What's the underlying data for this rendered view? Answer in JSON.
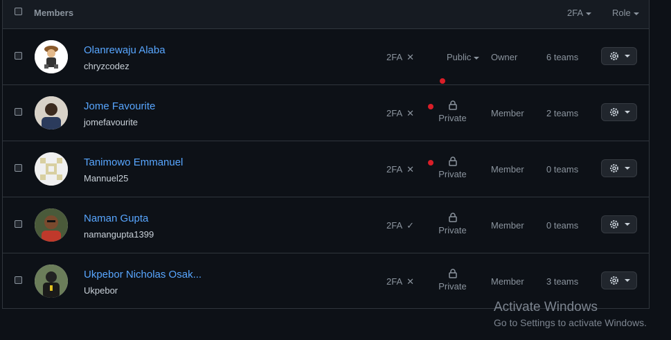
{
  "header": {
    "title": "Members",
    "filters": [
      {
        "label": "2FA"
      },
      {
        "label": "Role"
      }
    ]
  },
  "members": [
    {
      "name": "Olanrewaju Alaba",
      "login": "chryzcodez",
      "tfa": "2FA",
      "tfa_status": "✕",
      "visibility": "Public",
      "role": "Owner",
      "teams": "6 teams"
    },
    {
      "name": "Jome Favourite",
      "login": "jomefavourite",
      "tfa": "2FA",
      "tfa_status": "✕",
      "visibility": "Private",
      "role": "Member",
      "teams": "2 teams"
    },
    {
      "name": "Tanimowo Emmanuel",
      "login": "Mannuel25",
      "tfa": "2FA",
      "tfa_status": "✕",
      "visibility": "Private",
      "role": "Member",
      "teams": "0 teams"
    },
    {
      "name": "Naman Gupta",
      "login": "namangupta1399",
      "tfa": "2FA",
      "tfa_status": "✓",
      "visibility": "Private",
      "role": "Member",
      "teams": "0 teams"
    },
    {
      "name": "Ukpebor Nicholas Osak...",
      "login": "Ukpebor",
      "tfa": "2FA",
      "tfa_status": "✕",
      "visibility": "Private",
      "role": "Member",
      "teams": "3 teams"
    }
  ],
  "watermark": {
    "line1": "Activate Windows",
    "line2": "Go to Settings to activate Windows."
  },
  "colors": {
    "link": "#58a6ff",
    "alert_dot": "#da1e28",
    "bg": "#0d1117"
  }
}
